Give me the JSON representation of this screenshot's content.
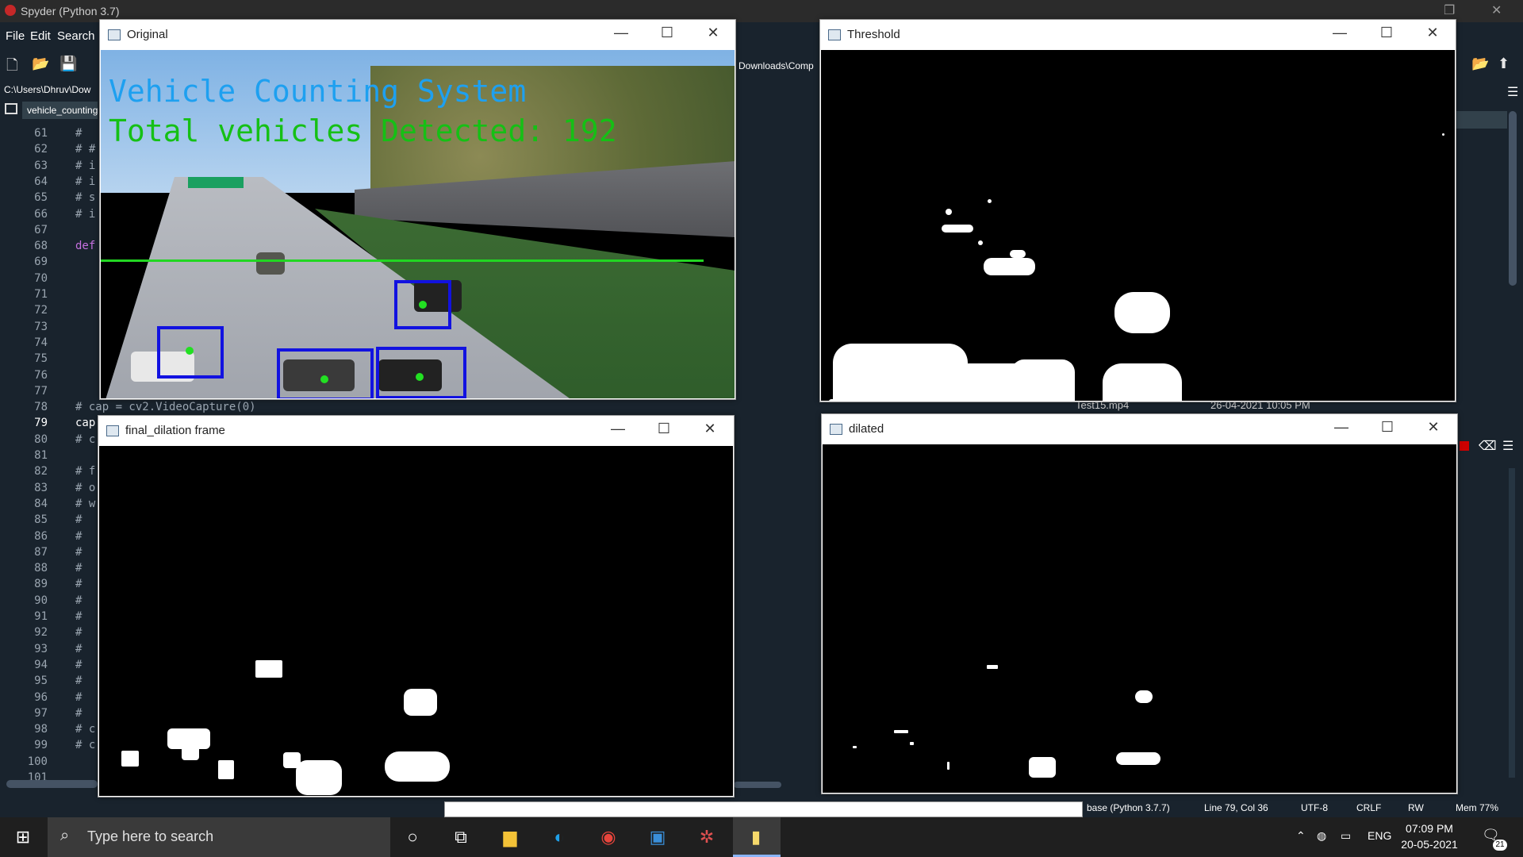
{
  "spyder": {
    "title": "Spyder (Python 3.7)",
    "menu": [
      "File",
      "Edit",
      "Search"
    ],
    "path": "C:\\Users\\Dhruv\\Dow",
    "tab": "vehicle_counting",
    "path_right": "Downloads\\Comp",
    "file_row": "Test15.mp4",
    "file_date": "26-04-2021 10:05 PM",
    "line_numbers": [
      "61",
      "62",
      "63",
      "64",
      "65",
      "66",
      "67",
      "68",
      "69",
      "70",
      "71",
      "72",
      "73",
      "74",
      "75",
      "76",
      "77",
      "78",
      "79",
      "80",
      "81",
      "82",
      "83",
      "84",
      "85",
      "86",
      "87",
      "88",
      "89",
      "90",
      "91",
      "92",
      "93",
      "94",
      "95",
      "96",
      "97",
      "98",
      "99",
      "100",
      "101"
    ],
    "code": {
      "61": "#",
      "62": "# #",
      "63": "# i",
      "64": "# i",
      "65": "# s",
      "66": "# i",
      "68": "def",
      "78": "# cap = cv2.VideoCapture(0)",
      "79": "cap",
      "80": "# c",
      "82": "# f",
      "83": "# o",
      "84": "# w",
      "85": "#",
      "86": "#",
      "87": "#",
      "88": "#",
      "89": "#",
      "90": "#",
      "91": "#",
      "92": "#",
      "93": "#",
      "94": "#",
      "95": "#",
      "96": "#",
      "97": "#",
      "98": "# c",
      "99": "# c"
    },
    "current_line": "79"
  },
  "status": {
    "env": "base (Python 3.7.7)",
    "cursor": "Line 79, Col 36",
    "encoding": "UTF-8",
    "eol": "CRLF",
    "perm": "RW",
    "mem": "Mem 77%"
  },
  "windows": {
    "original": {
      "title": "Original",
      "overlay_title": "Vehicle Counting System",
      "overlay_count": "Total vehicles Detected: 192",
      "overlay_color": "#1ea0f0",
      "count_color": "#15c015"
    },
    "threshold": {
      "title": "Threshold"
    },
    "final_dilation": {
      "title": "final_dilation frame"
    },
    "dilated": {
      "title": "dilated"
    }
  },
  "taskbar": {
    "search_placeholder": "Type here to search",
    "language": "ENG",
    "time": "07:09 PM",
    "date": "20-05-2021",
    "notifications": "21"
  }
}
